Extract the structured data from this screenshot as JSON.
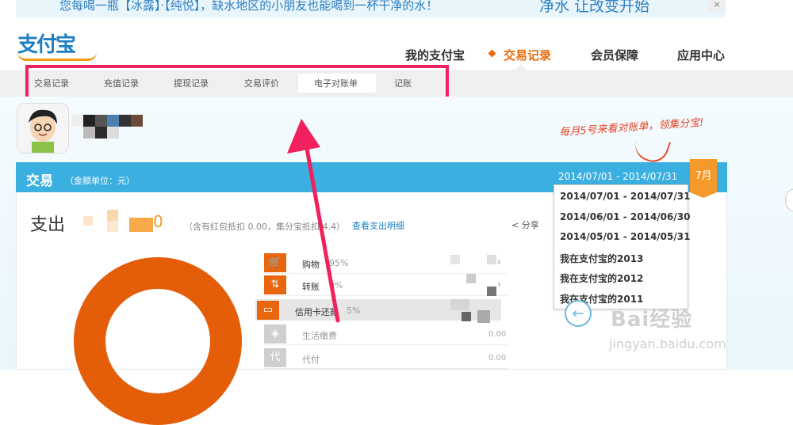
{
  "banner": {
    "text": "您每喝一瓶【冰露】·【纯悦】，缺水地区的小朋友也能喝到一杯干净的水！",
    "slogan": "净水 让改变开始",
    "close_label": "×"
  },
  "header": {
    "logo_text": "支付宝",
    "nav": [
      "我的支付宝",
      "交易记录",
      "会员保障",
      "应用中心"
    ],
    "active_nav_index": 1
  },
  "subnav": {
    "items": [
      "交易记录",
      "充值记录",
      "提现记录",
      "交易评价",
      "电子对账单",
      "记账"
    ],
    "active_index": 4
  },
  "promo_handwriting": "每月5号来看对账单，领集分宝!",
  "panel": {
    "title": "交易",
    "unit": "（金额单位：元）",
    "date_range": "2014/07/01 - 2014/07/31",
    "month_tag": "7月",
    "date_options": [
      "2014/07/01 - 2014/07/31",
      "2014/06/01 - 2014/06/30",
      "2014/05/01 - 2014/05/31",
      "我在支付宝的2013",
      "我在支付宝的2012",
      "我在支付宝的2011"
    ],
    "expense_label": "支出",
    "amount_visible_digit": "0",
    "deduct_note": "（含有红包抵扣 0.00，集分宝抵扣 4.4）",
    "detail_link": "查看支出明细",
    "share_label": "分享",
    "categories": [
      {
        "label": "购物",
        "pct": "95%",
        "value": "",
        "icon": "cart-icon",
        "color": "#e8670e"
      },
      {
        "label": "转账",
        "pct": "0%",
        "value": "",
        "icon": "transfer-icon",
        "color": "#e8670e"
      },
      {
        "label": "信用卡还款",
        "pct": "5%",
        "value": "",
        "icon": "credit-card-icon",
        "color": "#e8670e"
      },
      {
        "label": "生活缴费",
        "pct": "",
        "value": "0.00",
        "icon": "utility-icon",
        "color": "#cfcfcf"
      },
      {
        "label": "代付",
        "pct": "",
        "value": "0.00",
        "icon": "pay-for-icon",
        "color": "#cfcfcf"
      }
    ]
  },
  "watermark": {
    "logo": "Bai经验",
    "url": "jingyan.baidu.com"
  },
  "colors": {
    "accent_orange": "#e96b0b",
    "panel_blue": "#3bb0e0",
    "highlight_pink": "#f0215c",
    "logo_blue": "#1c7ec2"
  }
}
